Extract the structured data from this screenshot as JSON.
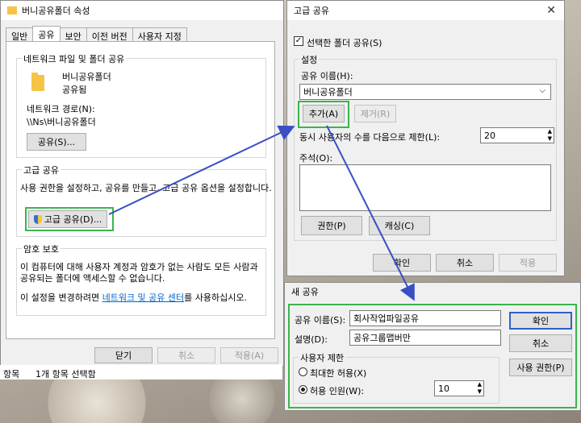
{
  "props": {
    "title": "버니공유폴더 속성",
    "tabs": [
      "일반",
      "공유",
      "보안",
      "이전 버전",
      "사용자 지정"
    ],
    "group1_title": "네트워크 파일 및 폴더 공유",
    "folder_name": "버니공유폴더",
    "folder_state": "공유됨",
    "path_label": "네트워크 경로(N):",
    "path_value": "\\\\Ns\\버니공유폴더",
    "share_button": "공유(S)...",
    "group2_title": "고급 공유",
    "adv_desc": "사용 권한을 설정하고, 공유를 만들고, 고급 공유 옵션을 설정합니다.",
    "adv_button": "고급 공유(D)...",
    "group3_title": "암호 보호",
    "pw_desc1": "이 컴퓨터에 대해 사용자 계정과 암호가 없는 사람도 모든 사람과",
    "pw_desc2": "공유되는 폴더에 액세스할 수 없습니다.",
    "pw_desc3_prefix": "이 설정을 변경하려면 ",
    "pw_link": "네트워크 및 공유 센터",
    "pw_desc3_suffix": "를 사용하십시오.",
    "close_button": "닫기",
    "cancel_button": "취소",
    "apply_button": "적용(A)"
  },
  "statusbar": {
    "items": "항목",
    "selected": "1개 항목 선택함"
  },
  "adv": {
    "title": "고급 공유",
    "share_check": "선택한 폴더 공유(S)",
    "settings_title": "설정",
    "share_name_label": "공유 이름(H):",
    "share_name_value": "버니공유폴더",
    "add_button": "추가(A)",
    "remove_button": "제거(R)",
    "limit_label": "동시 사용자의 수를 다음으로 제한(L):",
    "limit_value": "20",
    "comment_label": "주석(O):",
    "perm_button": "권한(P)",
    "cache_button": "캐싱(C)",
    "ok_button": "확인",
    "cancel_button": "취소",
    "apply_button": "적용"
  },
  "newshare": {
    "title": "새 공유",
    "name_label": "공유 이름(S):",
    "name_value": "회사작업파일공유",
    "desc_label": "설명(D):",
    "desc_value": "공유그룹맵버만",
    "limit_title": "사용자 제한",
    "max_label": "최대한 허용(X)",
    "allow_label": "허용 인원(W):",
    "allow_value": "10",
    "ok_button": "확인",
    "cancel_button": "취소",
    "perm_button": "사용 권한(P)"
  },
  "colors": {
    "highlight_green": "#3bb54a",
    "arrow_blue": "#3a4fc4",
    "link_blue": "#0066cc"
  }
}
